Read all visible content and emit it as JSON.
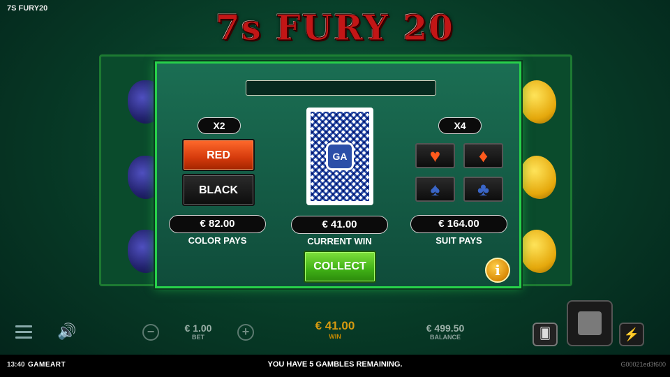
{
  "window": {
    "title": "7S FURY20"
  },
  "logo": {
    "text": "7s FURY 20"
  },
  "gamble": {
    "message": "",
    "color": {
      "multiplier": "X2",
      "red_label": "RED",
      "black_label": "BLACK",
      "pays": "€ 82.00",
      "pays_label": "COLOR PAYS"
    },
    "card": {
      "logo_text": "GA"
    },
    "current": {
      "win": "€ 41.00",
      "label": "CURRENT WIN"
    },
    "suit": {
      "multiplier": "X4",
      "pays": "€ 164.00",
      "pays_label": "SUIT PAYS"
    },
    "suits": [
      {
        "name": "hearts",
        "glyph": "♥",
        "color": "#ff5a1c"
      },
      {
        "name": "diamonds",
        "glyph": "♦",
        "color": "#ff5a1c"
      },
      {
        "name": "spades",
        "glyph": "♠",
        "color": "#3a66c8"
      },
      {
        "name": "clubs",
        "glyph": "♣",
        "color": "#3a66c8"
      }
    ],
    "collect_label": "COLLECT",
    "info_label": "i"
  },
  "bottom_bar": {
    "bet": {
      "value": "€ 1.00",
      "label": "BET",
      "minus": "−",
      "plus": "+"
    },
    "win": {
      "value": "€ 41.00",
      "label": "WIN"
    },
    "balance": {
      "value": "€ 499.50",
      "label": "BALANCE"
    },
    "icons": {
      "menu": "menu-icon",
      "sound": "speaker-icon",
      "gamble": "cards-icon",
      "spin": "stop-icon",
      "turbo": "lightning-icon"
    }
  },
  "footer": {
    "clock": "13:40",
    "brand": "GAMEART",
    "message": "YOU HAVE 5 GAMBLES REMAINING.",
    "game_id": "G00021ed3f600"
  }
}
